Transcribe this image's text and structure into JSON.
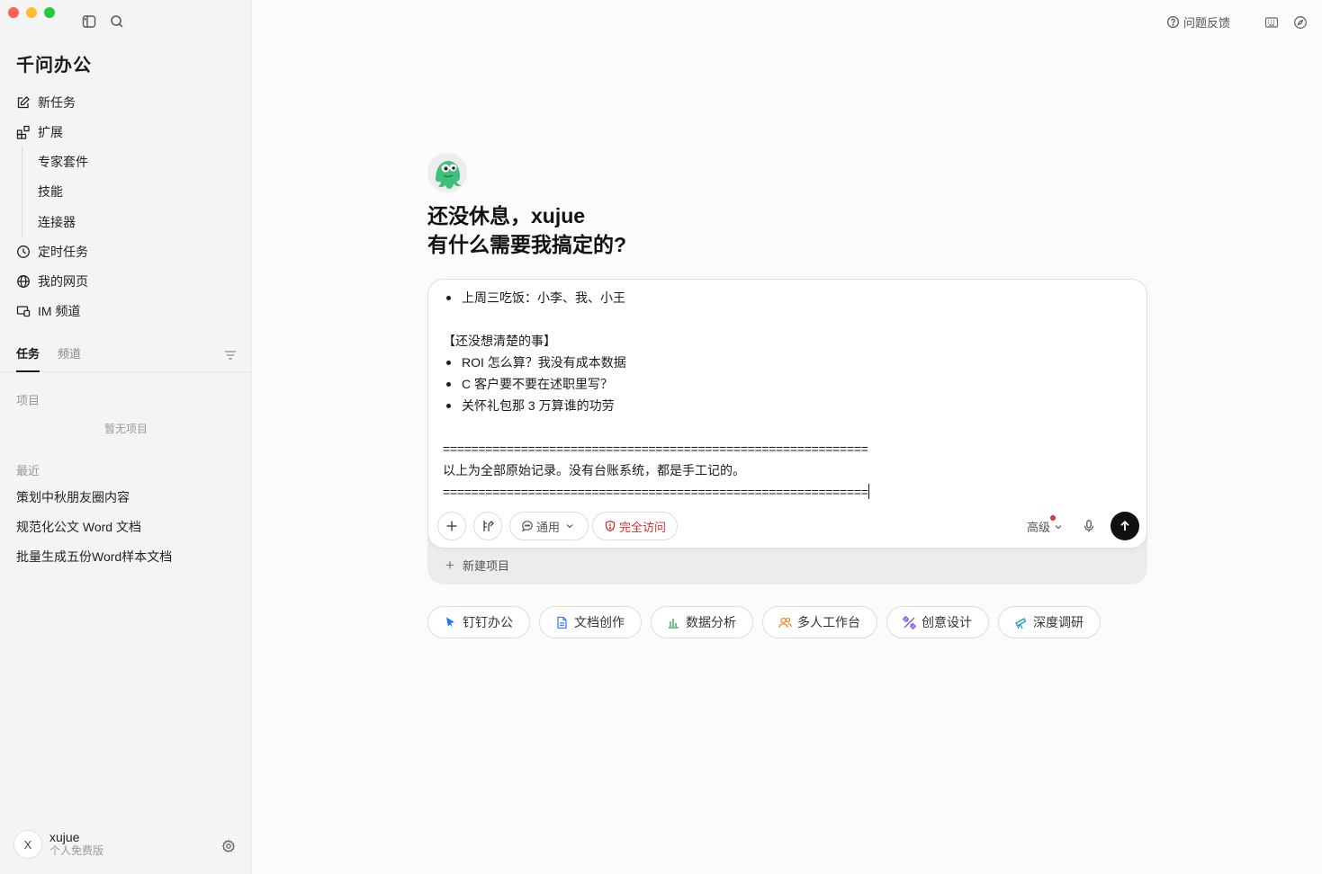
{
  "app": {
    "brand": "千问办公"
  },
  "sidebar": {
    "nav": [
      {
        "label": "新任务",
        "icon": "edit-icon"
      },
      {
        "label": "扩展",
        "icon": "extension-icon"
      }
    ],
    "subnav": [
      {
        "label": "专家套件"
      },
      {
        "label": "技能"
      },
      {
        "label": "连接器"
      }
    ],
    "nav2": [
      {
        "label": "定时任务",
        "icon": "clock-icon"
      },
      {
        "label": "我的网页",
        "icon": "globe-icon"
      },
      {
        "label": "IM 频道",
        "icon": "im-icon"
      }
    ],
    "tabs": [
      {
        "label": "任务"
      },
      {
        "label": "频道"
      }
    ],
    "projects_label": "项目",
    "projects_empty": "暂无项目",
    "recent_label": "最近",
    "recent": [
      {
        "label": "策划中秋朋友圈内容"
      },
      {
        "label": "规范化公文 Word 文档"
      },
      {
        "label": "批量生成五份Word样本文档"
      }
    ],
    "user": {
      "initial": "X",
      "name": "xujue",
      "plan": "个人免费版"
    }
  },
  "topbar": {
    "feedback": "问题反馈"
  },
  "main": {
    "greeting_line1": "还没休息，xujue",
    "greeting_line2": "有什么需要我搞定的?",
    "composer": {
      "lines": [
        {
          "type": "bullet",
          "text": "上周三吃饭：小李、我、小王"
        },
        {
          "type": "blank",
          "text": ""
        },
        {
          "type": "text",
          "text": "【还没想清楚的事】"
        },
        {
          "type": "bullet",
          "text": "ROI 怎么算？我没有成本数据"
        },
        {
          "type": "bullet",
          "text": "C 客户要不要在述职里写？"
        },
        {
          "type": "bullet",
          "text": "关怀礼包那 3 万算谁的功劳"
        },
        {
          "type": "blank",
          "text": ""
        },
        {
          "type": "sep",
          "text": "============================================================"
        },
        {
          "type": "text",
          "text": "以上为全部原始记录。没有台账系统，都是手工记的。"
        },
        {
          "type": "sep",
          "text": "============================================================"
        }
      ],
      "mode_label": "通用",
      "access_label": "完全访问",
      "advanced_label": "高级",
      "new_project": "新建项目"
    },
    "chips": [
      {
        "label": "钉钉办公",
        "icon": "dingtalk-icon",
        "color": "#1677ff"
      },
      {
        "label": "文档创作",
        "icon": "document-icon",
        "color": "#3b82f6"
      },
      {
        "label": "数据分析",
        "icon": "bar-chart-icon",
        "color": "#22a05a"
      },
      {
        "label": "多人工作台",
        "icon": "users-icon",
        "color": "#f08a24"
      },
      {
        "label": "创意设计",
        "icon": "design-icon",
        "color": "#7c5cf0"
      },
      {
        "label": "深度调研",
        "icon": "telescope-icon",
        "color": "#12a4b8"
      }
    ]
  }
}
